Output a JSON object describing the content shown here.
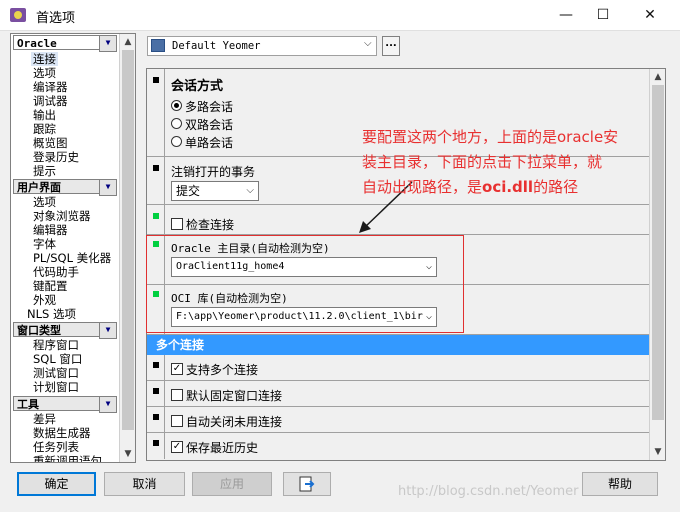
{
  "window": {
    "title": "首选项",
    "minimize": "—",
    "maximize": "☐",
    "close": "✕",
    "app_icon": "plsql-developer-icon"
  },
  "left_tree": {
    "groups": [
      {
        "label": "Oracle",
        "items": [
          "连接",
          "选项",
          "编译器",
          "调试器",
          "输出",
          "跟踪",
          "概览图",
          "登录历史",
          "提示"
        ]
      },
      {
        "label": "用户界面",
        "items": [
          "选项",
          "对象浏览器",
          "编辑器",
          "字体",
          "PL/SQL 美化器",
          "代码助手",
          "键配置",
          "外观",
          "NLS 选项"
        ]
      },
      {
        "label": "窗口类型",
        "items": [
          "程序窗口",
          "SQL 窗口",
          "测试窗口",
          "计划窗口"
        ]
      },
      {
        "label": "工具",
        "items": [
          "差异",
          "数据生成器",
          "任务列表",
          "重新调用语句"
        ]
      }
    ],
    "selected": "连接"
  },
  "toolbar": {
    "connection": "Default Yeomer",
    "more_button": "..."
  },
  "sections": {
    "session_mode": {
      "title": "会话方式",
      "options": [
        "多路会话",
        "双路会话",
        "单路会话"
      ],
      "selected": "多路会话"
    },
    "logoff": {
      "title": "注销打开的事务",
      "value": "提交"
    },
    "check_conn": {
      "label": "检查连接",
      "checked": false
    },
    "oracle_home": {
      "title": "Oracle 主目录(自动检测为空)",
      "value": "OraClient11g_home4"
    },
    "oci_lib": {
      "title": "OCI 库(自动检测为空)",
      "value": "F:\\app\\Yeomer\\product\\11.2.0\\client_1\\bir"
    },
    "multi_conn": {
      "header": "多个连接",
      "options": [
        {
          "label": "支持多个连接",
          "checked": true
        },
        {
          "label": "默认固定窗口连接",
          "checked": false
        },
        {
          "label": "自动关闭未用连接",
          "checked": false
        },
        {
          "label": "保存最近历史",
          "checked": true
        }
      ]
    }
  },
  "annotation": {
    "line1": "要配置这两个地方，上面的是oracle安",
    "line2": "装主目录，下面的点击下拉菜单，就",
    "line3_a": "自动出现路径，是",
    "line3_b": "oci.dll",
    "line3_c": "的路径",
    "color": "#e83030"
  },
  "buttons": {
    "ok": "确定",
    "cancel": "取消",
    "apply": "应用",
    "help": "帮助"
  },
  "watermark": "http://blog.csdn.net/Yeomer"
}
